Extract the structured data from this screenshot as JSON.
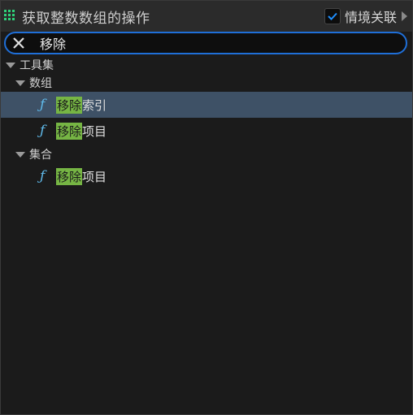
{
  "header": {
    "title": "获取整数数组的操作",
    "context_label": "情境关联",
    "context_checked": true,
    "accent": "#1f6fd8"
  },
  "search": {
    "value": "移除",
    "placeholder": ""
  },
  "tree": {
    "root": {
      "label": "工具集"
    },
    "group_array": {
      "label": "数组",
      "items": [
        {
          "highlight": "移除",
          "rest": "索引",
          "selected": true
        },
        {
          "highlight": "移除",
          "rest": "项目",
          "selected": false
        }
      ]
    },
    "group_set": {
      "label": "集合",
      "items": [
        {
          "highlight": "移除",
          "rest": "项目",
          "selected": false
        }
      ]
    },
    "function_glyph": "ƒ"
  },
  "colors": {
    "highlight": "#76b544",
    "selection": "#3e5166",
    "function_icon": "#5fb8e8"
  }
}
